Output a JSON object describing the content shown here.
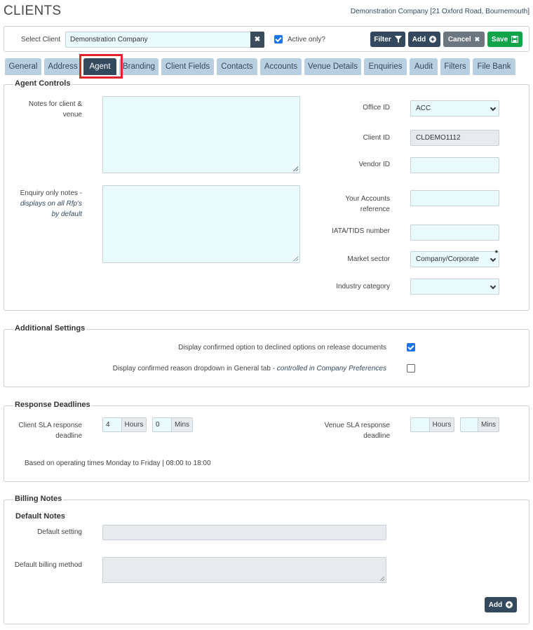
{
  "header": {
    "title": "CLIENTS",
    "company_info": "Demonstration Company [21 Oxford Road, Bournemouth]"
  },
  "toolbar": {
    "select_client_label": "Select Client",
    "selected_client": "Demonstration Company",
    "active_only_label": "Active only?",
    "active_only_checked": true,
    "filter_label": "Filter",
    "add_label": "Add",
    "cancel_label": "Cancel",
    "save_label": "Save"
  },
  "tabs": [
    {
      "label": "General"
    },
    {
      "label": "Address"
    },
    {
      "label": "Agent",
      "active": true
    },
    {
      "label": "Branding"
    },
    {
      "label": "Client Fields"
    },
    {
      "label": "Contacts"
    },
    {
      "label": "Accounts"
    },
    {
      "label": "Venue Details"
    },
    {
      "label": "Enquiries"
    },
    {
      "label": "Audit"
    },
    {
      "label": "Filters"
    },
    {
      "label": "File Bank"
    }
  ],
  "agent_controls": {
    "legend": "Agent Controls",
    "notes_label_line1": "Notes for client &",
    "notes_label_line2": "venue",
    "enquiry_label_line1": "Enquiry only notes -",
    "enquiry_label_line2": "displays on all Rfp's",
    "enquiry_label_line3": "by default",
    "office_id_label": "Office ID",
    "office_id_value": "ACC",
    "client_id_label": "Client ID",
    "client_id_value": "CLDEMO1112",
    "vendor_id_label": "Vendor ID",
    "accounts_ref_label_line1": "Your Accounts",
    "accounts_ref_label_line2": "reference",
    "iata_label": "IATA/TIDS number",
    "market_sector_label": "Market sector",
    "market_sector_value": "Company/Corporate",
    "industry_label": "Industry category"
  },
  "additional_settings": {
    "legend": "Additional Settings",
    "option1_label": "Display confirmed option to declined options on release documents",
    "option1_checked": true,
    "option2_label": "Display confirmed reason dropdown in General tab - ",
    "option2_note": "controlled in Company Preferences",
    "option2_checked": false
  },
  "response_deadlines": {
    "legend": "Response Deadlines",
    "client_sla_label_line1": "Client SLA response",
    "client_sla_label_line2": "deadline",
    "client_hours_value": "4",
    "client_mins_value": "0",
    "hours_unit": "Hours",
    "mins_unit": "Mins",
    "venue_sla_label_line1": "Venue SLA response",
    "venue_sla_label_line2": "deadline",
    "venue_hours_value": "",
    "venue_mins_value": "",
    "operating_note": "Based on operating times Monday to Friday | 08:00 to 18:00"
  },
  "billing_notes": {
    "legend": "Billing Notes",
    "sub_heading": "Default Notes",
    "default_setting_label": "Default setting",
    "default_billing_label": "Default billing method",
    "add_label": "Add"
  }
}
